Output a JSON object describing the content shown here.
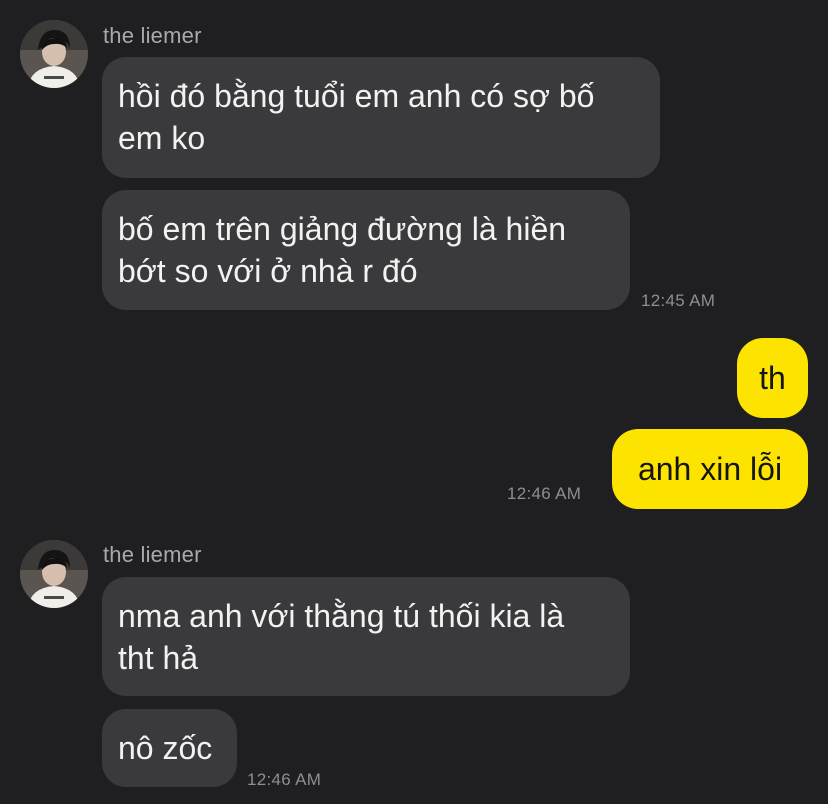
{
  "conversation": {
    "group1": {
      "sender_name": "the liemer",
      "avatar": "profile-photo",
      "messages": [
        "hồi đó bằng tuổi em anh có sợ bố\nem ko",
        "bố em trên giảng đường là hiền\nbớt so với ở nhà r đó"
      ],
      "timestamp": "12:45 AM"
    },
    "group2": {
      "messages": [
        "th",
        "anh xin lỗi"
      ],
      "timestamp": "12:46 AM"
    },
    "group3": {
      "sender_name": "the liemer",
      "avatar": "profile-photo",
      "messages": [
        "nma anh với thằng tú thối kia là\ntht hả",
        "nô zốc"
      ],
      "timestamp": "12:46 AM"
    }
  },
  "colors": {
    "background": "#1f1f21",
    "incoming_bubble": "#3a3a3c",
    "outgoing_bubble": "#fde300",
    "sender_name": "#a9a9ad",
    "timestamp": "#8e8e93"
  }
}
